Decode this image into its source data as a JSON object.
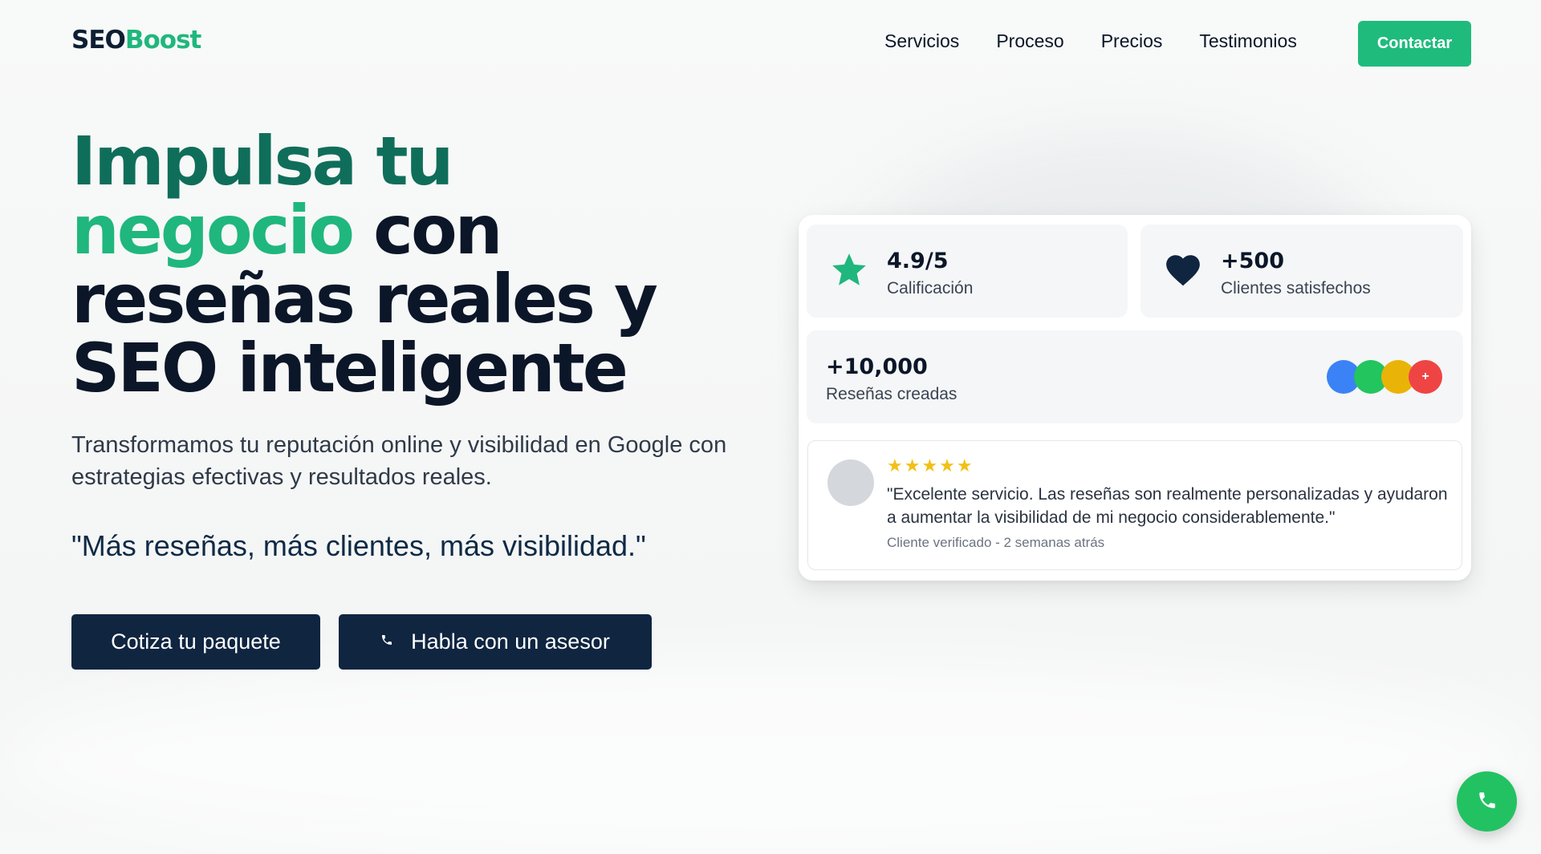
{
  "brand": {
    "logo_part1": "SEO",
    "logo_part2": "Boost",
    "logo_color_dark": "#0d1f33",
    "logo_color_accent": "#1fb77d"
  },
  "nav": {
    "items": [
      {
        "label": "Servicios"
      },
      {
        "label": "Proceso"
      },
      {
        "label": "Precios"
      },
      {
        "label": "Testimonios"
      }
    ],
    "cta_label": "Contactar",
    "cta_color": "#1fbb7c"
  },
  "hero": {
    "title_part1": "Impulsa",
    "title_part2": "tu",
    "title_part3": "negocio",
    "title_part4": "con reseñas reales y SEO inteligente",
    "subtitle": "Transformamos tu reputación online y visibilidad en Google con estrategias efectivas y resultados reales.",
    "quote": "\"Más reseñas, más clientes, más visibilidad.\"",
    "primary_button": "Cotiza tu paquete",
    "secondary_button": "Habla con un asesor",
    "secondary_button_icon": "phone-icon",
    "button_color": "#0f2540"
  },
  "stats": {
    "rating": {
      "value": "4.9/5",
      "label": "Calificación",
      "icon": "star-icon"
    },
    "clients": {
      "value": "+500",
      "label": "Clientes satisfechos",
      "icon": "heart-icon"
    },
    "reviews": {
      "value": "+10,000",
      "label": "Reseñas creadas"
    },
    "avatar_colors": [
      "#3b82f6",
      "#22c55e",
      "#eab308",
      "#ef4444"
    ],
    "avatar_more": "+"
  },
  "review": {
    "stars": "★★★★★",
    "rating": 5,
    "text": "\"Excelente servicio. Las reseñas son realmente personalizadas y ayudaron a aumentar la visibilidad de mi negocio considerablemente.\"",
    "meta": "Cliente verificado - 2 semanas atrás"
  },
  "fab": {
    "icon": "phone-icon",
    "color": "#22c263"
  }
}
